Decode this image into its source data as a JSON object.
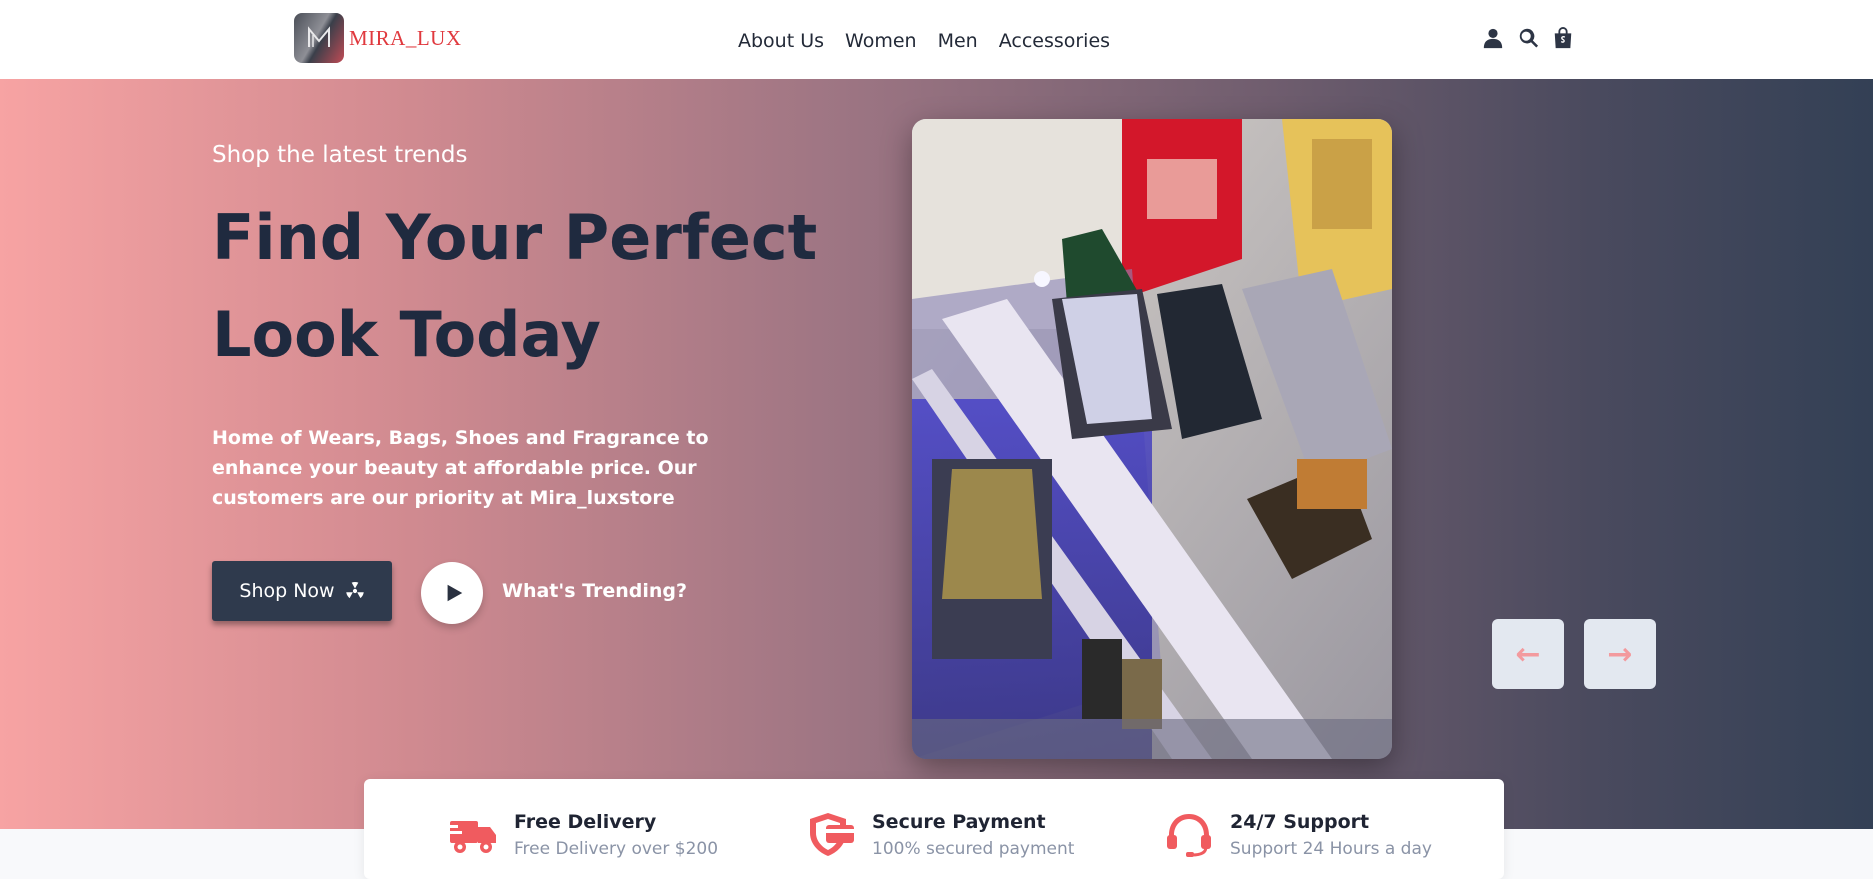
{
  "brand": {
    "name": "MIRA_LUX",
    "logo_icon": "mira-monogram-logo",
    "logo_colors": [
      "#4a4e57",
      "#c14b55"
    ],
    "name_color": "#e0393e"
  },
  "nav": {
    "items": [
      "About Us",
      "Women",
      "Men",
      "Accessories"
    ]
  },
  "header_icons": [
    "user-icon",
    "search-icon",
    "shopping-bag-icon"
  ],
  "hero": {
    "subtitle": "Shop the latest trends",
    "title": "Find Your Perfect Look Today",
    "description": "Home of Wears, Bags, Shoes and Fragrance to enhance your beauty at affordable price. Our customers are our priority at Mira_luxstore",
    "shop_now_label": "Shop Now",
    "shop_now_icon": "radiation-icon",
    "trending_label": "What's Trending?",
    "play_icon": "play-icon",
    "image_alt": "store-interior-photo",
    "gradient_colors": [
      "#f7a3a3",
      "#334055"
    ]
  },
  "carousel": {
    "prev_label": "←",
    "next_label": "→",
    "arrow_color": "#f39a9e"
  },
  "features": [
    {
      "icon": "truck-icon",
      "title": "Free Delivery",
      "subtitle": "Free Delivery over $200"
    },
    {
      "icon": "shield-card-icon",
      "title": "Secure Payment",
      "subtitle": "100% secured payment"
    },
    {
      "icon": "headset-icon",
      "title": "24/7 Support",
      "subtitle": "Support 24 Hours a day"
    }
  ],
  "accent_color": "#f05b5f"
}
